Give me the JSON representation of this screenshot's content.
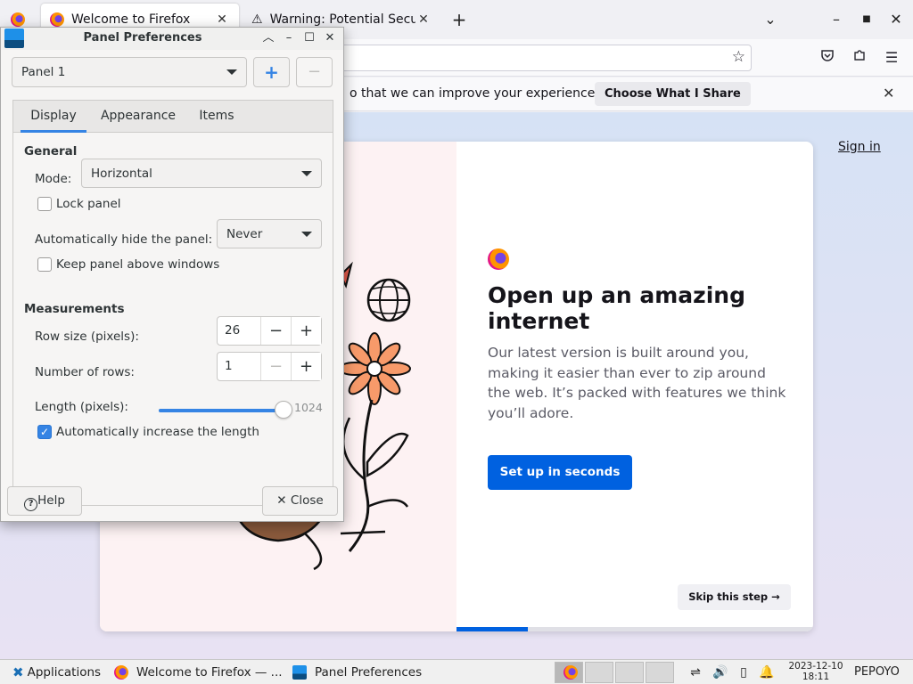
{
  "firefox": {
    "tabs": [
      {
        "title": "Welcome to Firefox",
        "active": true
      },
      {
        "title": "Warning: Potential Secur",
        "active": false
      }
    ],
    "new_tab_icon": "plus-icon",
    "list_tabs_icon": "chevron-down-icon",
    "window_controls": [
      "minimize-icon",
      "maximize-icon",
      "close-icon"
    ],
    "nav_icons": [
      "bookmark-star-icon",
      "pocket-icon",
      "extensions-icon",
      "menu-icon"
    ],
    "notification": {
      "text": "o that we can improve your experience.",
      "button": "Choose What I Share",
      "close_icon": "close-icon"
    },
    "page": {
      "sign_in": "Sign in",
      "title": "Open up an amazing internet",
      "body": "Our latest version is built around you, making it easier than ever to zip around the web. It’s packed with features we think you’ll adore.",
      "cta": "Set up in seconds",
      "skip": "Skip this step →",
      "progress_fraction": 0.2,
      "accent_color": "#0061e0"
    }
  },
  "dialog": {
    "title": "Panel Preferences",
    "panel_select": "Panel 1",
    "add_panel_icon": "plus-icon",
    "remove_panel_icon": "minus-icon",
    "tabs": [
      "Display",
      "Appearance",
      "Items"
    ],
    "active_tab": "Display",
    "general": {
      "header": "General",
      "mode_label": "Mode:",
      "mode_value": "Horizontal",
      "lock_panel_label": "Lock panel",
      "lock_panel_checked": false,
      "autohide_label": "Automatically hide the panel:",
      "autohide_value": "Never",
      "keep_above_label": "Keep panel above windows",
      "keep_above_checked": false
    },
    "measurements": {
      "header": "Measurements",
      "row_size_label": "Row size (pixels):",
      "row_size_value": "26",
      "rows_label": "Number of rows:",
      "rows_value": "1",
      "length_label": "Length (pixels):",
      "length_value": "1024",
      "length_fraction": 1.0,
      "auto_increase_label": "Automatically increase the length",
      "auto_increase_checked": true
    },
    "help_button": "Help",
    "close_button": "Close",
    "accent_color": "#3584e4"
  },
  "taskbar": {
    "applications_label": "Applications",
    "windows": [
      {
        "title": "Welcome to Firefox — ...",
        "icon": "firefox-icon"
      },
      {
        "title": "Panel Preferences",
        "icon": "panel-prefs-icon"
      }
    ],
    "workspaces": 4,
    "tray_icons": [
      "network-icon",
      "volume-icon",
      "battery-icon",
      "notification-bell-icon"
    ],
    "date": "2023-12-10",
    "time": "18:11",
    "user": "PEPOYO"
  }
}
